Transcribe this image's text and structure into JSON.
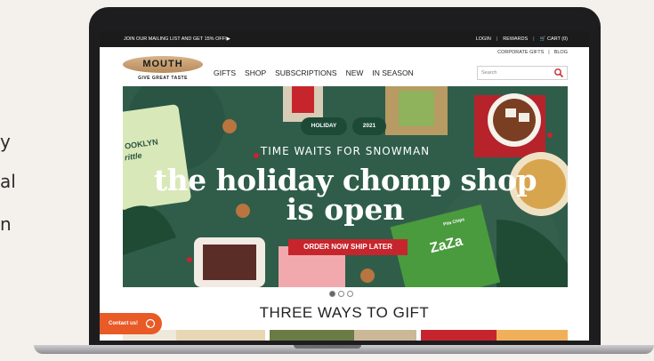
{
  "side_text": [
    "y",
    "al",
    "n"
  ],
  "topbar": {
    "promo": "JOIN OUR MAILING LIST AND GET 15% OFF!▶",
    "login": "LOGIN",
    "rewards": "REWARDS",
    "cart": "🛒 CART (0)"
  },
  "secondary_links": {
    "corporate": "CORPORATE GIFTS",
    "blog": "BLOG"
  },
  "logo": {
    "name": "MOUTH",
    "tagline": "GIVE GREAT TASTE"
  },
  "nav": [
    "GIFTS",
    "SHOP",
    "SUBSCRIPTIONS",
    "NEW",
    "IN SEASON"
  ],
  "search": {
    "placeholder": "Search"
  },
  "hero": {
    "badge_holiday": "HOLIDAY",
    "badge_year": "2021",
    "line1": "TIME WAITS FOR SNOWMAN",
    "line2": "the holiday chomp shop",
    "line3": "is open",
    "cta": "ORDER NOW SHIP LATER",
    "label_brooklyn": "OOKLYN",
    "label_brittle": "rittle",
    "label_zaza": "ZaZa",
    "label_pita": "Pita Chips"
  },
  "carousel": {
    "total": 3,
    "active": 1
  },
  "section": {
    "title": "THREE WAYS TO GIFT"
  },
  "contact": {
    "label": "Contact us!"
  },
  "colors": {
    "accent": "#c7252d",
    "contact": "#e85a26",
    "hero_bg": "#2f5d4a"
  }
}
